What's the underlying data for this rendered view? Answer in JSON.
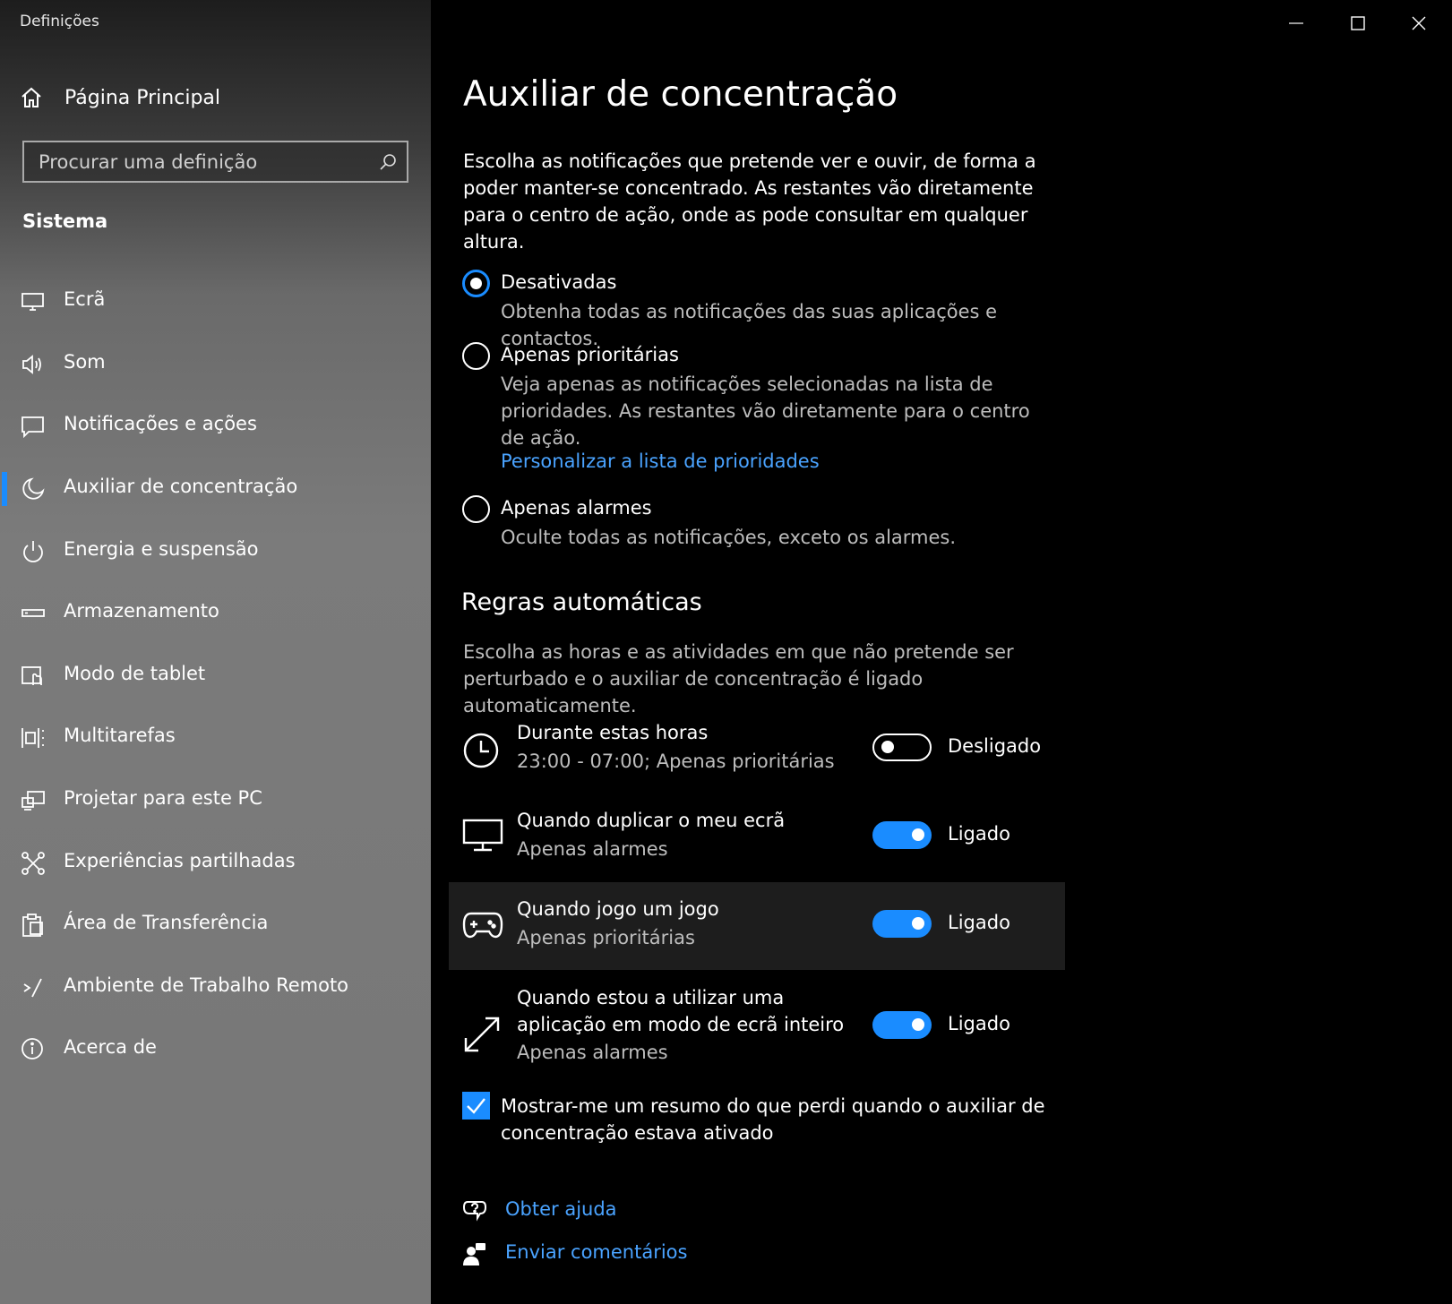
{
  "app": {
    "title": "Definições"
  },
  "sidebar": {
    "home_label": "Página Principal",
    "search_placeholder": "Procurar uma definição",
    "section": "Sistema",
    "items": [
      {
        "label": "Ecrã",
        "icon": "monitor-icon"
      },
      {
        "label": "Som",
        "icon": "speaker-icon"
      },
      {
        "label": "Notificações e ações",
        "icon": "notification-icon"
      },
      {
        "label": "Auxiliar de concentração",
        "icon": "moon-icon",
        "active": true
      },
      {
        "label": "Energia e suspensão",
        "icon": "power-icon"
      },
      {
        "label": "Armazenamento",
        "icon": "storage-icon"
      },
      {
        "label": "Modo de tablet",
        "icon": "tablet-mode-icon"
      },
      {
        "label": "Multitarefas",
        "icon": "multitasking-icon"
      },
      {
        "label": "Projetar para este PC",
        "icon": "project-icon"
      },
      {
        "label": "Experiências partilhadas",
        "icon": "shared-experiences-icon"
      },
      {
        "label": "Área de Transferência",
        "icon": "clipboard-icon"
      },
      {
        "label": "Ambiente de Trabalho Remoto",
        "icon": "remote-desktop-icon"
      },
      {
        "label": "Acerca de",
        "icon": "info-icon"
      }
    ]
  },
  "main": {
    "title": "Auxiliar de concentração",
    "intro": "Escolha as notificações que pretende ver e ouvir, de forma a poder manter-se concentrado. As restantes vão diretamente para o centro de ação, onde as pode consultar em qualquer altura.",
    "options": [
      {
        "title": "Desativadas",
        "desc": "Obtenha todas as notificações das suas aplicações e contactos.",
        "selected": true
      },
      {
        "title": "Apenas prioritárias",
        "desc": "Veja apenas as notificações selecionadas na lista de prioridades. As restantes vão diretamente para o centro de ação.",
        "link": "Personalizar a lista de prioridades",
        "selected": false
      },
      {
        "title": "Apenas alarmes",
        "desc": "Oculte todas as notificações, exceto os alarmes.",
        "selected": false
      }
    ],
    "rules_heading": "Regras automáticas",
    "rules_intro": "Escolha as horas e as atividades em que não pretende ser perturbado e o auxiliar de concentração é ligado automaticamente.",
    "rules": [
      {
        "name": "Durante estas horas",
        "sub": "23:00 - 07:00; Apenas prioritárias",
        "state": "Desligado",
        "on": false,
        "icon": "clock-icon"
      },
      {
        "name": "Quando duplicar o meu ecrã",
        "sub": "Apenas alarmes",
        "state": "Ligado",
        "on": true,
        "icon": "monitor-icon"
      },
      {
        "name": "Quando jogo um jogo",
        "sub": "Apenas prioritárias",
        "state": "Ligado",
        "on": true,
        "icon": "gamepad-icon"
      },
      {
        "name": "Quando estou a utilizar uma aplicação em modo de ecrã inteiro",
        "sub": "Apenas alarmes",
        "state": "Ligado",
        "on": true,
        "icon": "fullscreen-icon"
      }
    ],
    "summary_checkbox": {
      "label": "Mostrar-me um resumo do que perdi quando o auxiliar de concentração estava ativado",
      "checked": true
    },
    "help": {
      "get_help": "Obter ajuda",
      "feedback": "Enviar comentários"
    }
  },
  "colors": {
    "accent": "#1a8cff",
    "link": "#4aa3ff",
    "background": "#000000"
  }
}
